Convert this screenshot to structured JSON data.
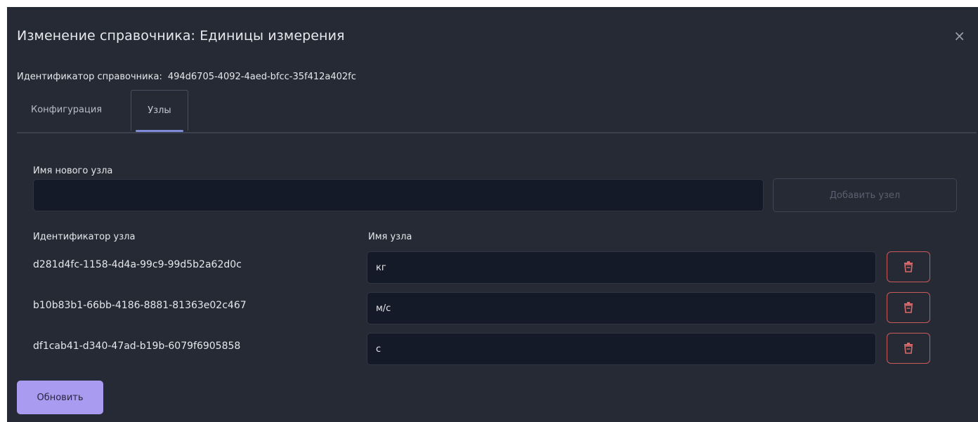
{
  "dialog": {
    "title": "Изменение справочника: Единицы измерения",
    "close_glyph": "×",
    "identifier_label": "Идентификатор справочника:",
    "identifier_value": "494d6705-4092-4aed-bfcc-35f412a402fc"
  },
  "tabs": [
    {
      "label": "Конфигурация",
      "active": false
    },
    {
      "label": "Узлы",
      "active": true
    }
  ],
  "new_node": {
    "label": "Имя нового узла",
    "value": "",
    "add_button_label": "Добавить узел"
  },
  "table": {
    "columns": [
      "Идентификатор узла",
      "Имя узла"
    ],
    "rows": [
      {
        "id": "d281d4fc-1158-4d4a-99c9-99d5b2a62d0c",
        "name": "кг"
      },
      {
        "id": "b10b83b1-66bb-4186-8881-81363e02c467",
        "name": "м/с"
      },
      {
        "id": "df1cab41-d340-47ad-b19b-6079f6905858",
        "name": "с"
      }
    ],
    "delete_icon": "trash-icon"
  },
  "update_button_label": "Обновить",
  "colors": {
    "background": "#262a34",
    "input_bg": "#141a27",
    "accent": "#a99cf0",
    "tab_underline": "#7e8cd8",
    "danger": "#c75a5a"
  }
}
